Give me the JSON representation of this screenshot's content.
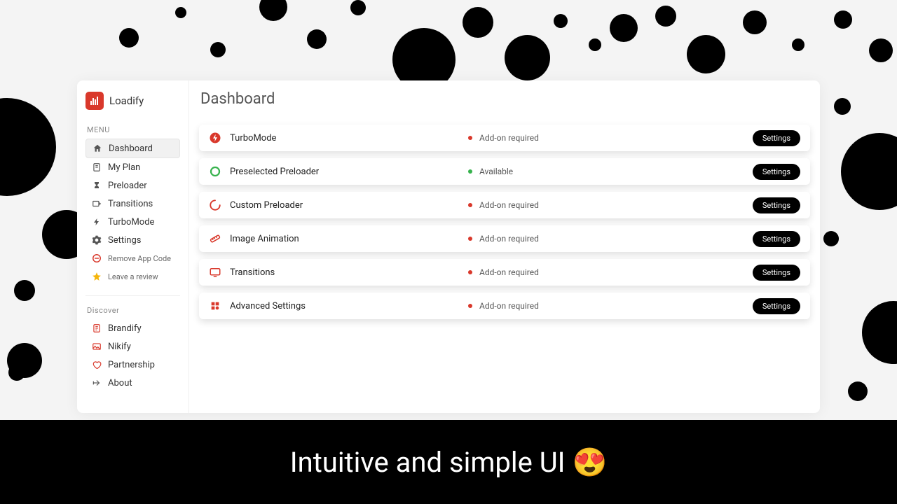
{
  "brand": {
    "name": "Loadify"
  },
  "sidebar": {
    "menu_label": "MENU",
    "items": [
      {
        "label": "Dashboard"
      },
      {
        "label": "My Plan"
      },
      {
        "label": "Preloader"
      },
      {
        "label": "Transitions"
      },
      {
        "label": "TurboMode"
      },
      {
        "label": "Settings"
      },
      {
        "label": "Remove App Code"
      },
      {
        "label": "Leave a review"
      }
    ],
    "discover_label": "Discover",
    "discover": [
      {
        "label": "Brandify"
      },
      {
        "label": "Nikify"
      },
      {
        "label": "Partnership"
      },
      {
        "label": "About"
      }
    ]
  },
  "page": {
    "title": "Dashboard",
    "settings_label": "Settings",
    "status_required": "Add-on required",
    "status_available": "Available",
    "cards": [
      {
        "name": "TurboMode"
      },
      {
        "name": "Preselected Preloader"
      },
      {
        "name": "Custom Preloader"
      },
      {
        "name": "Image Animation"
      },
      {
        "name": "Transitions"
      },
      {
        "name": "Advanced Settings"
      }
    ]
  },
  "caption": "Intuitive and simple UI 😍"
}
